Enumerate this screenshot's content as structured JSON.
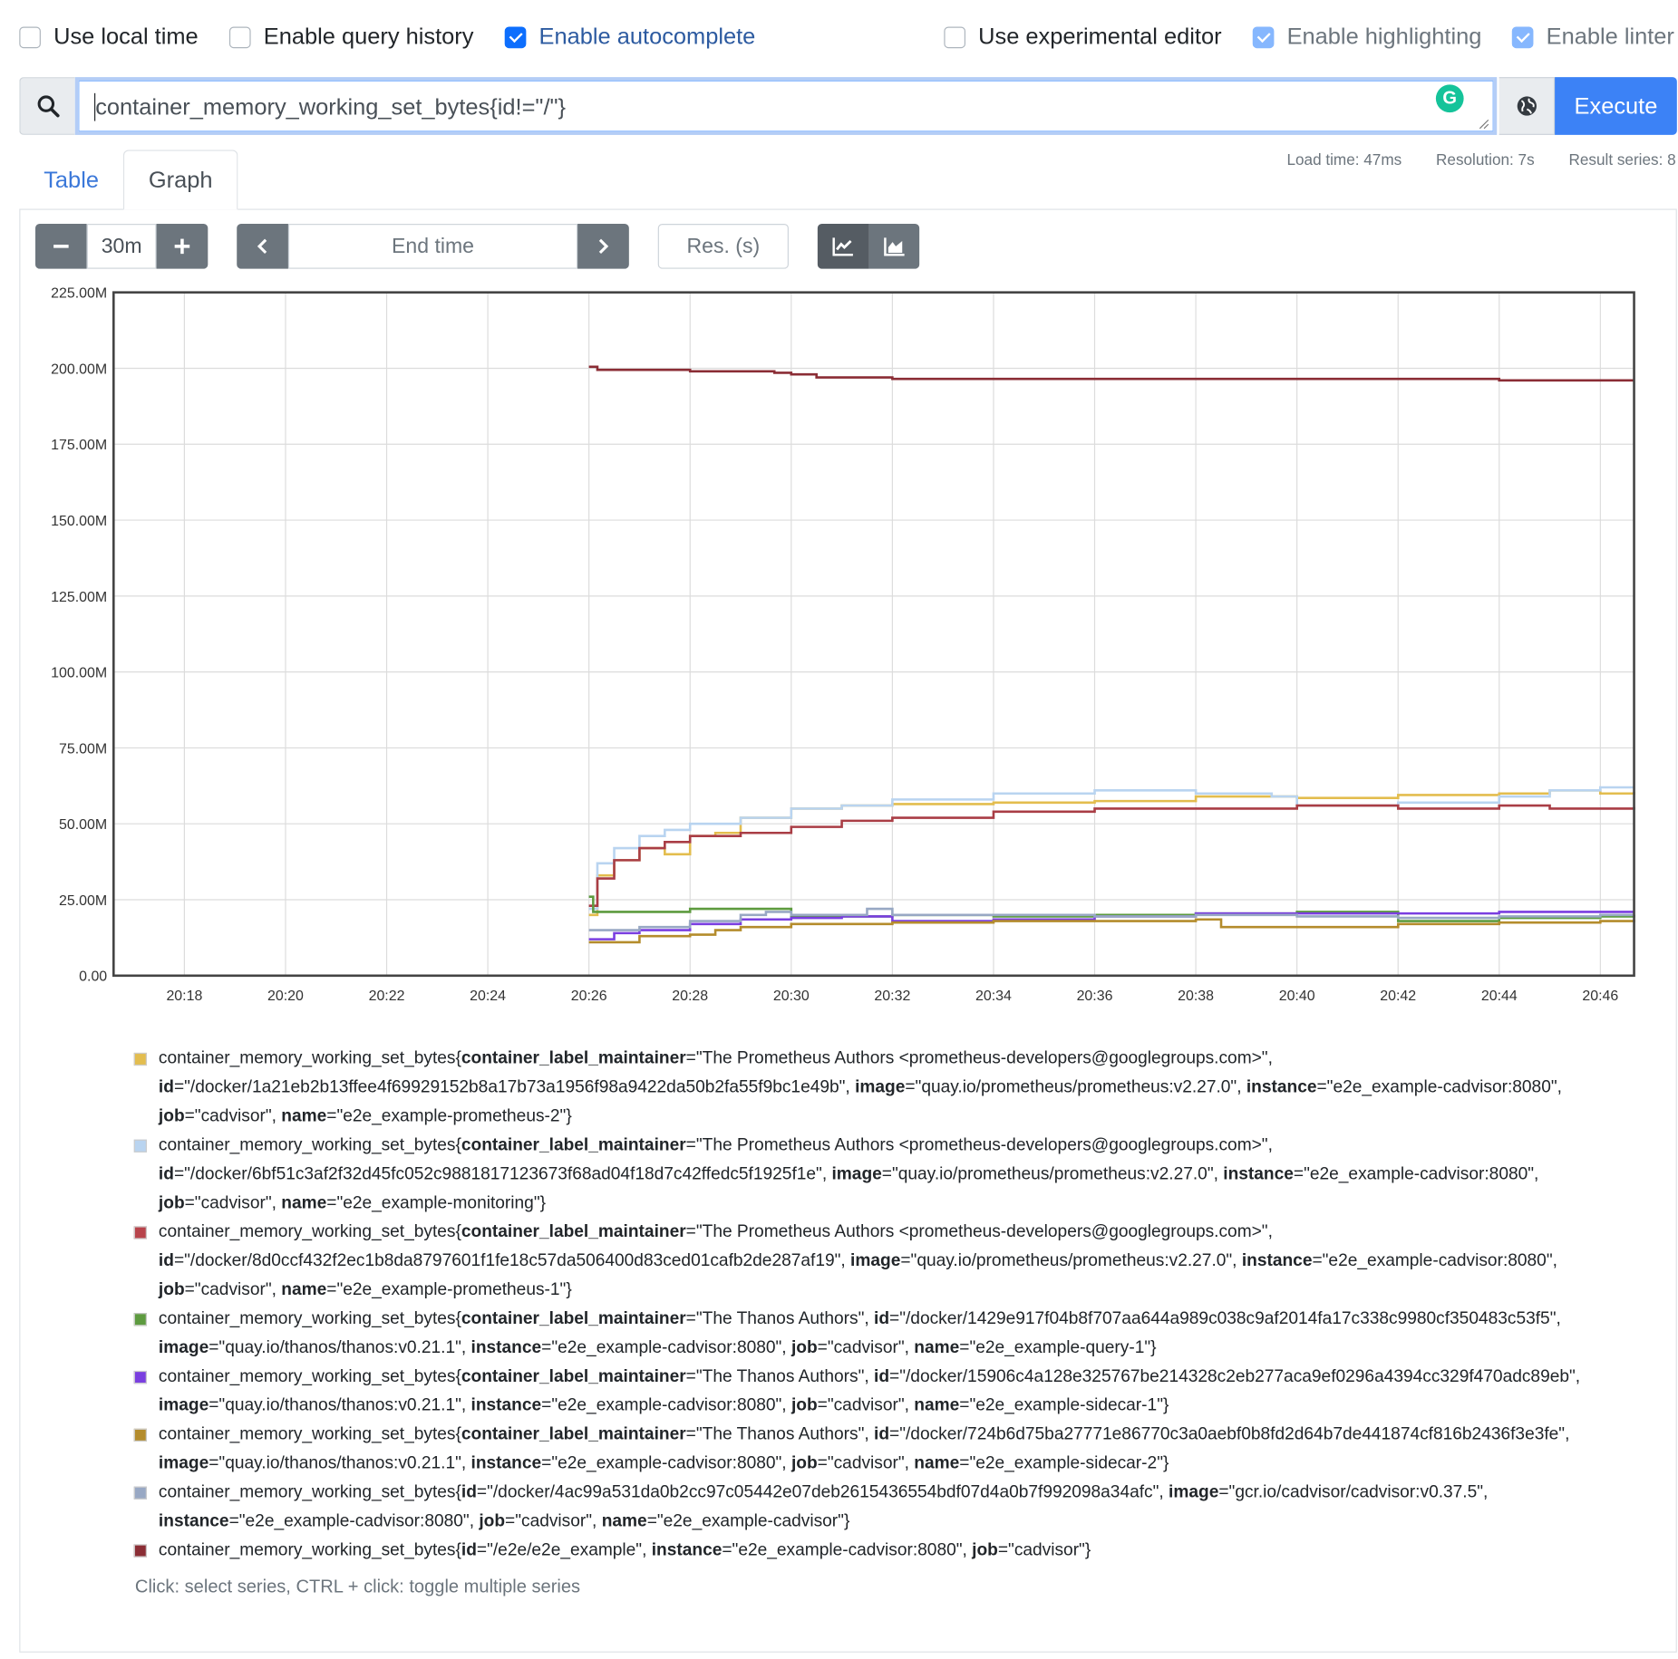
{
  "options": {
    "local_time": {
      "label": "Use local time",
      "checked": false
    },
    "query_history": {
      "label": "Enable query history",
      "checked": false
    },
    "autocomplete": {
      "label": "Enable autocomplete",
      "checked": true
    },
    "experimental_editor": {
      "label": "Use experimental editor",
      "checked": false
    },
    "highlighting": {
      "label": "Enable highlighting",
      "checked": true
    },
    "linter": {
      "label": "Enable linter",
      "checked": true
    }
  },
  "query": {
    "expression": "container_memory_working_set_bytes{id!=\"/\"}",
    "execute_label": "Execute",
    "grammarly_glyph": "G"
  },
  "meta": {
    "load_time": "Load time: 47ms",
    "resolution": "Resolution: 7s",
    "result_series": "Result series: 8"
  },
  "tabs": [
    {
      "label": "Table",
      "active": false
    },
    {
      "label": "Graph",
      "active": true
    }
  ],
  "graph_controls": {
    "range": "30m",
    "end_time_placeholder": "End time",
    "resolution_placeholder": "Res. (s)"
  },
  "chart_data": {
    "type": "line",
    "title": "",
    "xlabel": "",
    "ylabel": "",
    "x_ticks": [
      "20:18",
      "20:20",
      "20:22",
      "20:24",
      "20:26",
      "20:28",
      "20:30",
      "20:32",
      "20:34",
      "20:36",
      "20:38",
      "20:40",
      "20:42",
      "20:44",
      "20:46"
    ],
    "y_ticks": [
      "0.00",
      "25.00M",
      "50.00M",
      "75.00M",
      "100.00M",
      "125.00M",
      "150.00M",
      "175.00M",
      "200.00M",
      "225.00M"
    ],
    "xlim_minutes": [
      "20:16:36",
      "20:46:40"
    ],
    "ylim": [
      0,
      225000000
    ],
    "grid": true,
    "series": [
      {
        "name": "e2e_example-prometheus-2",
        "color": "#e3bd4e",
        "x": [
          "20:26",
          "20:26:10",
          "20:26:30",
          "20:27",
          "20:27:30",
          "20:28",
          "20:28:30",
          "20:29",
          "20:30",
          "20:31",
          "20:32",
          "20:34",
          "20:36",
          "20:38",
          "20:40",
          "20:42",
          "20:44",
          "20:45",
          "20:46",
          "20:46:40"
        ],
        "y": [
          20000000,
          33000000,
          38000000,
          42000000,
          40000000,
          46000000,
          47000000,
          52000000,
          55000000,
          56000000,
          56500000,
          57000000,
          57500000,
          59000000,
          58500000,
          59500000,
          60000000,
          61000000,
          60000000,
          60500000
        ]
      },
      {
        "name": "e2e_example-monitoring",
        "color": "#b9d4f0",
        "x": [
          "20:26",
          "20:26:10",
          "20:26:30",
          "20:27",
          "20:27:30",
          "20:28",
          "20:29",
          "20:30",
          "20:31",
          "20:32",
          "20:34",
          "20:36",
          "20:37",
          "20:38",
          "20:39",
          "20:39:30",
          "20:40",
          "20:42",
          "20:44",
          "20:45",
          "20:46",
          "20:46:40"
        ],
        "y": [
          22000000,
          37000000,
          42000000,
          46000000,
          48000000,
          50000000,
          52000000,
          55000000,
          56000000,
          58000000,
          60000000,
          61000000,
          61000000,
          60000000,
          60000000,
          59000000,
          56000000,
          57000000,
          59000000,
          61000000,
          62000000,
          62000000
        ]
      },
      {
        "name": "e2e_example-prometheus-1",
        "color": "#a93d45",
        "x": [
          "20:26",
          "20:26:10",
          "20:26:30",
          "20:27",
          "20:27:30",
          "20:28",
          "20:29",
          "20:30",
          "20:31",
          "20:32",
          "20:34",
          "20:36",
          "20:38",
          "20:40",
          "20:41",
          "20:42",
          "20:44",
          "20:45",
          "20:46",
          "20:46:40"
        ],
        "y": [
          23000000,
          32000000,
          38000000,
          42000000,
          44000000,
          46000000,
          47000000,
          49000000,
          51000000,
          52000000,
          54000000,
          55000000,
          55000000,
          56000000,
          56000000,
          55000000,
          56000000,
          55000000,
          55000000,
          55500000
        ]
      },
      {
        "name": "e2e_example-query-1",
        "color": "#5d9b3f",
        "x": [
          "20:26",
          "20:26:05",
          "20:27",
          "20:28",
          "20:29",
          "20:29:30",
          "20:30",
          "20:32",
          "20:34",
          "20:36",
          "20:38",
          "20:40",
          "20:41",
          "20:42",
          "20:44",
          "20:46",
          "20:46:40"
        ],
        "y": [
          26000000,
          21000000,
          21000000,
          22000000,
          22000000,
          22000000,
          19500000,
          20000000,
          19500000,
          20000000,
          20500000,
          21000000,
          21000000,
          18000000,
          19000000,
          19500000,
          20000000
        ]
      },
      {
        "name": "e2e_example-sidecar-1",
        "color": "#7a3ee0",
        "x": [
          "20:26",
          "20:26:30",
          "20:27",
          "20:28",
          "20:29",
          "20:30",
          "20:31",
          "20:32",
          "20:34",
          "20:36",
          "20:38",
          "20:40",
          "20:42",
          "20:44",
          "20:46",
          "20:46:40"
        ],
        "y": [
          12000000,
          14000000,
          15000000,
          17000000,
          18500000,
          19000000,
          19500000,
          18000000,
          18500000,
          19500000,
          20500000,
          20500000,
          20500000,
          21000000,
          21000000,
          21000000
        ]
      },
      {
        "name": "e2e_example-sidecar-2",
        "color": "#b48c2c",
        "x": [
          "20:26",
          "20:26:10",
          "20:27",
          "20:28",
          "20:28:30",
          "20:29",
          "20:30",
          "20:31",
          "20:32",
          "20:34",
          "20:36",
          "20:38",
          "20:38:30",
          "20:40",
          "20:42",
          "20:44",
          "20:46",
          "20:46:40"
        ],
        "y": [
          11000000,
          11000000,
          13000000,
          13500000,
          15000000,
          16000000,
          17000000,
          17000000,
          17500000,
          18000000,
          18000000,
          18500000,
          16000000,
          16000000,
          17000000,
          17500000,
          18000000,
          18500000
        ]
      },
      {
        "name": "e2e_example-cadvisor",
        "color": "#98a8c4",
        "x": [
          "20:26",
          "20:27",
          "20:28",
          "20:29",
          "20:29:30",
          "20:30",
          "20:31",
          "20:31:30",
          "20:32",
          "20:34",
          "20:36",
          "20:38",
          "20:40",
          "20:42",
          "20:44",
          "20:46",
          "20:46:40"
        ],
        "y": [
          15000000,
          16000000,
          18000000,
          20000000,
          21000000,
          20000000,
          20000000,
          22000000,
          20000000,
          20000000,
          19500000,
          20000000,
          19500000,
          19000000,
          19500000,
          20000000,
          20000000
        ]
      },
      {
        "name": "/e2e/e2e_example",
        "color": "#8b2d35",
        "x": [
          "20:26",
          "20:26:10",
          "20:27",
          "20:28",
          "20:29",
          "20:29:40",
          "20:30",
          "20:30:30",
          "20:32",
          "20:34",
          "20:36",
          "20:38",
          "20:40",
          "20:42",
          "20:44",
          "20:46",
          "20:46:40"
        ],
        "y": [
          200500000,
          199500000,
          199500000,
          199000000,
          199000000,
          198500000,
          198000000,
          197000000,
          196500000,
          196500000,
          196500000,
          196500000,
          196500000,
          196500000,
          196000000,
          196000000,
          196000000
        ]
      }
    ]
  },
  "legend": {
    "items": [
      {
        "color": "#e3bd4e",
        "parts": [
          {
            "t": "container_memory_working_set_bytes{"
          },
          {
            "t": "container_label_maintainer",
            "b": true
          },
          {
            "t": "=\"The Prometheus Authors <prometheus-developers@googlegroups.com>\", "
          },
          {
            "t": "id",
            "b": true
          },
          {
            "t": "=\"/docker/1a21eb2b13ffee4f69929152b8a17b73a1956f98a9422da50b2fa55f9bc1e49b\", "
          },
          {
            "t": "image",
            "b": true
          },
          {
            "t": "=\"quay.io/prometheus/prometheus:v2.27.0\", "
          },
          {
            "t": "instance",
            "b": true
          },
          {
            "t": "=\"e2e_example-cadvisor:8080\", "
          },
          {
            "t": "job",
            "b": true
          },
          {
            "t": "=\"cadvisor\", "
          },
          {
            "t": "name",
            "b": true
          },
          {
            "t": "=\"e2e_example-prometheus-2\"}"
          }
        ]
      },
      {
        "color": "#b9d4f0",
        "parts": [
          {
            "t": "container_memory_working_set_bytes{"
          },
          {
            "t": "container_label_maintainer",
            "b": true
          },
          {
            "t": "=\"The Prometheus Authors <prometheus-developers@googlegroups.com>\", "
          },
          {
            "t": "id",
            "b": true
          },
          {
            "t": "=\"/docker/6bf51c3af2f32d45fc052c9881817123673f68ad04f18d7c42ffedc5f1925f1e\", "
          },
          {
            "t": "image",
            "b": true
          },
          {
            "t": "=\"quay.io/prometheus/prometheus:v2.27.0\", "
          },
          {
            "t": "instance",
            "b": true
          },
          {
            "t": "=\"e2e_example-cadvisor:8080\", "
          },
          {
            "t": "job",
            "b": true
          },
          {
            "t": "=\"cadvisor\", "
          },
          {
            "t": "name",
            "b": true
          },
          {
            "t": "=\"e2e_example-monitoring\"}"
          }
        ]
      },
      {
        "color": "#b8434b",
        "parts": [
          {
            "t": "container_memory_working_set_bytes{"
          },
          {
            "t": "container_label_maintainer",
            "b": true
          },
          {
            "t": "=\"The Prometheus Authors <prometheus-developers@googlegroups.com>\", "
          },
          {
            "t": "id",
            "b": true
          },
          {
            "t": "=\"/docker/8d0ccf432f2ec1b8da8797601f1fe18c57da506400d83ced01cafb2de287af19\", "
          },
          {
            "t": "image",
            "b": true
          },
          {
            "t": "=\"quay.io/prometheus/prometheus:v2.27.0\", "
          },
          {
            "t": "instance",
            "b": true
          },
          {
            "t": "=\"e2e_example-cadvisor:8080\", "
          },
          {
            "t": "job",
            "b": true
          },
          {
            "t": "=\"cadvisor\", "
          },
          {
            "t": "name",
            "b": true
          },
          {
            "t": "=\"e2e_example-prometheus-1\"}"
          }
        ]
      },
      {
        "color": "#5d9b3f",
        "parts": [
          {
            "t": "container_memory_working_set_bytes{"
          },
          {
            "t": "container_label_maintainer",
            "b": true
          },
          {
            "t": "=\"The Thanos Authors\", "
          },
          {
            "t": "id",
            "b": true
          },
          {
            "t": "=\"/docker/1429e917f04b8f707aa644a989c038c9af2014fa17c338c9980cf350483c53f5\", "
          },
          {
            "t": "image",
            "b": true
          },
          {
            "t": "=\"quay.io/thanos/thanos:v0.21.1\", "
          },
          {
            "t": "instance",
            "b": true
          },
          {
            "t": "=\"e2e_example-cadvisor:8080\", "
          },
          {
            "t": "job",
            "b": true
          },
          {
            "t": "=\"cadvisor\", "
          },
          {
            "t": "name",
            "b": true
          },
          {
            "t": "=\"e2e_example-query-1\"}"
          }
        ]
      },
      {
        "color": "#7a3ee0",
        "parts": [
          {
            "t": "container_memory_working_set_bytes{"
          },
          {
            "t": "container_label_maintainer",
            "b": true
          },
          {
            "t": "=\"The Thanos Authors\", "
          },
          {
            "t": "id",
            "b": true
          },
          {
            "t": "=\"/docker/15906c4a128e325767be214328c2eb277aca9ef0296a4394cc329f470adc89eb\", "
          },
          {
            "t": "image",
            "b": true
          },
          {
            "t": "=\"quay.io/thanos/thanos:v0.21.1\", "
          },
          {
            "t": "instance",
            "b": true
          },
          {
            "t": "=\"e2e_example-cadvisor:8080\", "
          },
          {
            "t": "job",
            "b": true
          },
          {
            "t": "=\"cadvisor\", "
          },
          {
            "t": "name",
            "b": true
          },
          {
            "t": "=\"e2e_example-sidecar-1\"}"
          }
        ]
      },
      {
        "color": "#b48c2c",
        "parts": [
          {
            "t": "container_memory_working_set_bytes{"
          },
          {
            "t": "container_label_maintainer",
            "b": true
          },
          {
            "t": "=\"The Thanos Authors\", "
          },
          {
            "t": "id",
            "b": true
          },
          {
            "t": "=\"/docker/724b6d75ba27771e86770c3a0aebf0b8fd2d64b7de441874cf816b2436f3e3fe\", "
          },
          {
            "t": "image",
            "b": true
          },
          {
            "t": "=\"quay.io/thanos/thanos:v0.21.1\", "
          },
          {
            "t": "instance",
            "b": true
          },
          {
            "t": "=\"e2e_example-cadvisor:8080\", "
          },
          {
            "t": "job",
            "b": true
          },
          {
            "t": "=\"cadvisor\", "
          },
          {
            "t": "name",
            "b": true
          },
          {
            "t": "=\"e2e_example-sidecar-2\"}"
          }
        ]
      },
      {
        "color": "#98a8c4",
        "parts": [
          {
            "t": "container_memory_working_set_bytes{"
          },
          {
            "t": "id",
            "b": true
          },
          {
            "t": "=\"/docker/4ac99a531da0b2cc97c05442e07deb2615436554bdf07d4a0b7f992098a34afc\", "
          },
          {
            "t": "image",
            "b": true
          },
          {
            "t": "=\"gcr.io/cadvisor/cadvisor:v0.37.5\", "
          },
          {
            "t": "instance",
            "b": true
          },
          {
            "t": "=\"e2e_example-cadvisor:8080\", "
          },
          {
            "t": "job",
            "b": true
          },
          {
            "t": "=\"cadvisor\", "
          },
          {
            "t": "name",
            "b": true
          },
          {
            "t": "=\"e2e_example-cadvisor\"}"
          }
        ]
      },
      {
        "color": "#8b2d35",
        "parts": [
          {
            "t": "container_memory_working_set_bytes{"
          },
          {
            "t": "id",
            "b": true
          },
          {
            "t": "=\"/e2e/e2e_example\", "
          },
          {
            "t": "instance",
            "b": true
          },
          {
            "t": "=\"e2e_example-cadvisor:8080\", "
          },
          {
            "t": "job",
            "b": true
          },
          {
            "t": "=\"cadvisor\"}"
          }
        ]
      }
    ],
    "hint": "Click: select series, CTRL + click: toggle multiple series"
  },
  "icons": {
    "search": "search-icon",
    "globe": "globe-icon",
    "minus": "minus-icon",
    "plus": "plus-icon",
    "prev": "chevron-left-icon",
    "next": "chevron-right-icon",
    "line": "line-chart-icon",
    "stacked": "area-chart-icon"
  },
  "colors": {
    "accent": "#3c82f6",
    "button_gray": "#6c757d"
  }
}
